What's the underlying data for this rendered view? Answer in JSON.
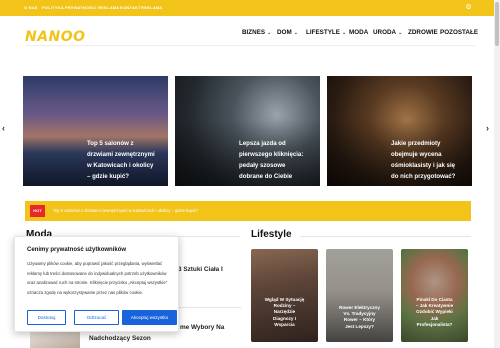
{
  "topbar": {
    "links": [
      "O NAS",
      "POLITYKA PRYWATNOŚCI",
      "REKLAMA",
      "KONTAKT",
      "REKLAMA"
    ],
    "settings_icon": "gear-icon"
  },
  "logo": {
    "text": "NANOO"
  },
  "nav": {
    "items": [
      {
        "label": "BIZNES",
        "has_dropdown": true
      },
      {
        "label": "DOM",
        "has_dropdown": true
      },
      {
        "label": "LIFESTYLE",
        "has_dropdown": true
      },
      {
        "label": "MODA",
        "has_dropdown": false
      },
      {
        "label": "URODA",
        "has_dropdown": true
      },
      {
        "label": "ZDROWIE",
        "has_dropdown": false
      },
      {
        "label": "POZOSTAŁE",
        "has_dropdown": false
      }
    ],
    "chevron": "⌄"
  },
  "slider": {
    "prev": "‹",
    "next": "›",
    "cards": [
      {
        "title_lines": [
          "Top 5 salonów z",
          "drzwiami zewnętrznymi",
          "w Katowicach i okolicy",
          "– gdzie kupić?"
        ]
      },
      {
        "title_lines": [
          "Lepsza jazda od",
          "pierwszego kliknięcia:",
          "pedały szosowe",
          "dobrane do Ciebie"
        ]
      },
      {
        "title_lines": [
          "Jakie przedmioty",
          "obejmuje wycena",
          "ośmioklasisty i jak się",
          "do nich przygotować?"
        ]
      }
    ]
  },
  "ticker": {
    "badge": "HOT",
    "text": "Top 5 salonów z drzwiami zewnętrznymi w Katowicach i okolicy – gdzie kupić?"
  },
  "sections": {
    "moda": {
      "title": "Moda",
      "items": [
        {
          "title_lines": [
            "3 Sztuki Ciała I"
          ]
        },
        {
          "title_lines": [
            "me Wybory Na"
          ]
        },
        {
          "title_lines": [
            "Nadchodzący Sezon"
          ]
        }
      ]
    },
    "lifestyle": {
      "title": "Lifestyle",
      "cards": [
        {
          "title_lines": [
            "Wgląd W Sytuację",
            "Rodziny –",
            "Narzędzie",
            "Diagnozy I",
            "Wsparcia"
          ]
        },
        {
          "title_lines": [
            "Rower Elektryczny",
            "Vs. Tradycyjny",
            "Rower – Który",
            "Jest Lepszy?"
          ]
        },
        {
          "title_lines": [
            "Pinakl Do Ciasta",
            "– Jak Kreatywnie",
            "Ozdobić Wypieki",
            "Jak",
            "Profesjonalista?"
          ]
        }
      ]
    }
  },
  "cookie": {
    "title": "Cenimy prywatność użytkowników",
    "body": "Używamy plików cookie, aby poprawić jakość przeglądania, wyświetlać reklamy lub treści dostosowane do indywidualnych potrzeb użytkowników oraz analizować ruch na stronie. Kliknięcie przycisku „Akceptuj wszystkie” oznacza zgodę na wykorzystywanie przez nas plików cookie.",
    "buttons": {
      "customize": "Dostosuj",
      "reject": "Odrzucać",
      "accept": "Akceptuj wszystko"
    }
  },
  "colors": {
    "accent": "#f2c318",
    "hot": "#e8262b",
    "button_blue": "#1863dc"
  }
}
